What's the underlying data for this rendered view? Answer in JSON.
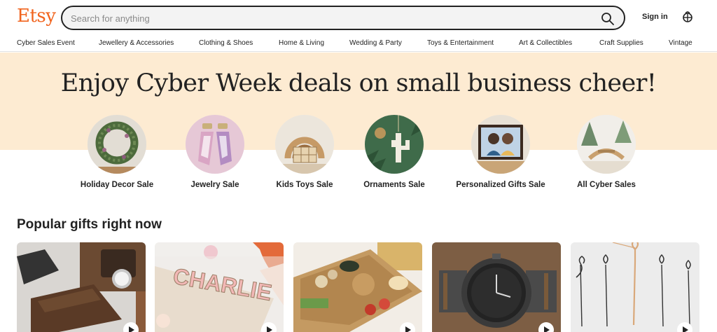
{
  "header": {
    "logo": "Etsy",
    "search_placeholder": "Search for anything",
    "signin_label": "Sign in",
    "icons": {
      "search": "search-icon",
      "cart": "shopping-basket-icon"
    },
    "colors": {
      "brand": "#f1641e"
    }
  },
  "nav": {
    "items": [
      "Cyber Sales Event",
      "Jewellery & Accessories",
      "Clothing & Shoes",
      "Home & Living",
      "Wedding & Party",
      "Toys & Entertainment",
      "Art & Collectibles",
      "Craft Supplies",
      "Vintage"
    ]
  },
  "banner": {
    "title": "Enjoy Cyber Week deals on small business cheer!",
    "background": "#fdebd2"
  },
  "categories": [
    {
      "label": "Holiday Decor Sale"
    },
    {
      "label": "Jewelry Sale"
    },
    {
      "label": "Kids Toys Sale"
    },
    {
      "label": "Ornaments Sale"
    },
    {
      "label": "Personalized Gifts Sale"
    },
    {
      "label": "All Cyber Sales"
    }
  ],
  "popular": {
    "title": "Popular gifts right now",
    "cards": [
      {
        "name": "leather-wallet-product",
        "has_video": true
      },
      {
        "name": "name-puzzle-product",
        "puzzle_text": "CHARLIE",
        "has_video": true
      },
      {
        "name": "charcuterie-board-product",
        "has_video": true
      },
      {
        "name": "wooden-watch-product",
        "has_video": true
      },
      {
        "name": "birth-flower-necklace-product",
        "has_video": true
      }
    ]
  }
}
